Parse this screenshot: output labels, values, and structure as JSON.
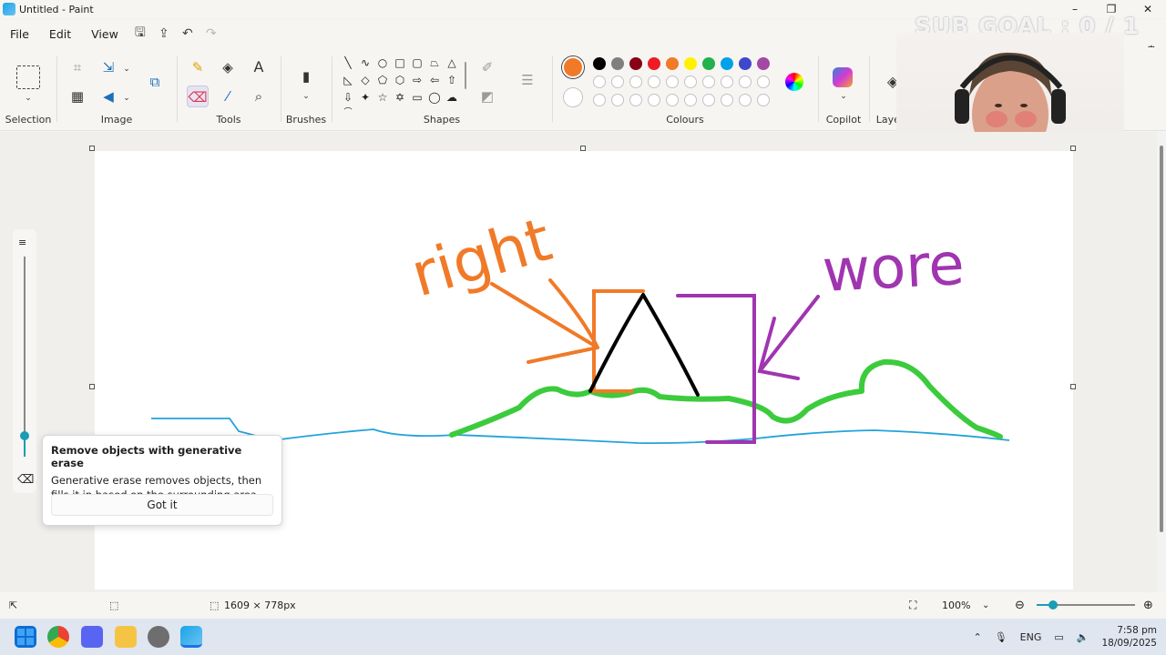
{
  "window": {
    "title": "Untitled - Paint",
    "controls": [
      "–",
      "❐",
      "✕"
    ]
  },
  "overlay": {
    "subgoal": "SUB GOAL : 0 / 1"
  },
  "menu": {
    "items": [
      "File",
      "Edit",
      "View"
    ]
  },
  "ribbon": {
    "groups": {
      "selection": "Selection",
      "image": "Image",
      "tools": "Tools",
      "brushes": "Brushes",
      "shapes": "Shapes",
      "colours": "Colours",
      "copilot": "Copilot",
      "layers": "Layers"
    },
    "palette": {
      "primary": "#F07A28",
      "secondary": "#FFFFFF",
      "row1": [
        "#000000",
        "#7F7F7F",
        "#880015",
        "#ED1C24",
        "#F07A28",
        "#FFF200",
        "#22B14C",
        "#00A2E8",
        "#3F48CC",
        "#A349A4"
      ],
      "row2": [
        "#FFFFFF",
        "#C3C3C3",
        "#B97A57",
        "#FFAEC9",
        "#FFC90E",
        "#EFE4B0",
        "#B5E61D",
        "#99D9EA",
        "#7092BE",
        "#C8BFE7"
      ]
    }
  },
  "canvas": {
    "texts": {
      "right": "right",
      "wore": "wore"
    }
  },
  "popup": {
    "title": "Remove objects with generative erase",
    "body": "Generative erase removes objects, then fills it in based on the surrounding area",
    "button": "Got it"
  },
  "status": {
    "canvas_size": "1609 × 778px",
    "zoom": "100%"
  },
  "taskbar": {
    "lang": "ENG",
    "time": "7:58 pm",
    "date": "18/09/2025"
  }
}
